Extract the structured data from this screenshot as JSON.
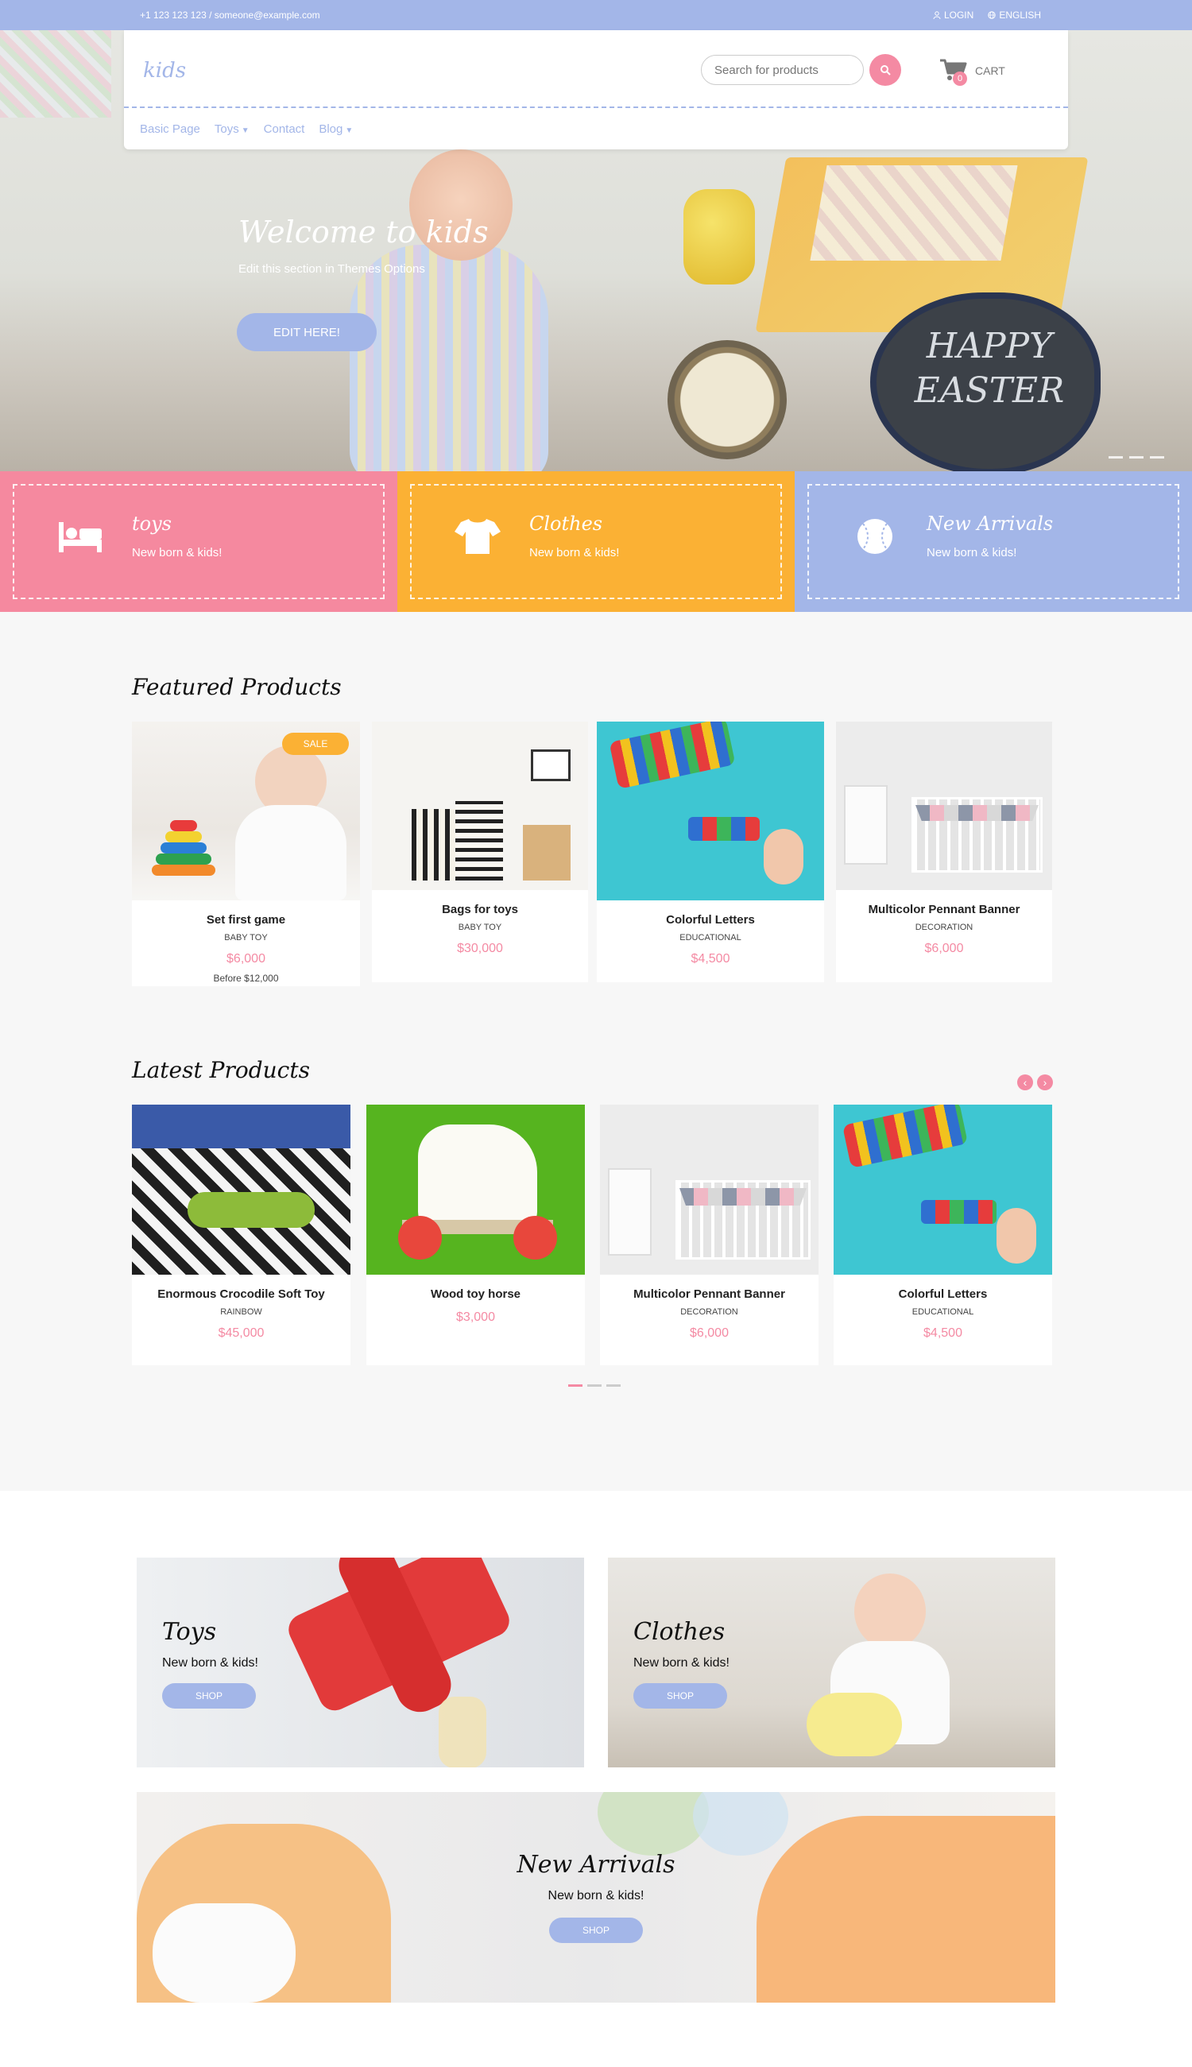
{
  "topbar": {
    "contact": "+1 123 123 123 /  someone@example.com",
    "login": "LOGIN",
    "language": "ENGLISH"
  },
  "header": {
    "logo": "kids",
    "search_placeholder": "Search for products",
    "cart_count": "0",
    "cart_label": "CART",
    "nav": [
      {
        "label": "Basic Page"
      },
      {
        "label": "Toys"
      },
      {
        "label": "Contact"
      },
      {
        "label": "Blog"
      }
    ]
  },
  "hero": {
    "title": "Welcome to kids",
    "subtitle": "Edit this section in Themes Options",
    "button": "EDIT HERE!",
    "chalkboard": "HAPPY EASTER"
  },
  "tiles": [
    {
      "name": "toys",
      "sub": "New born & kids!",
      "color": "#f5899f",
      "icon": "bed-icon"
    },
    {
      "name": "Clothes",
      "sub": "New born & kids!",
      "color": "#fbb134",
      "icon": "tshirt-icon"
    },
    {
      "name": "New Arrivals",
      "sub": "New born & kids!",
      "color": "#a3b6e8",
      "icon": "baseball-icon"
    }
  ],
  "featured": {
    "title": "Featured Products",
    "sale_label": "SALE",
    "items": [
      {
        "name": "Set first game",
        "category": "BABY TOY",
        "price": "$6,000",
        "before": "Before $12,000"
      },
      {
        "name": "Bags for toys",
        "category": "BABY TOY",
        "price": "$30,000"
      },
      {
        "name": "Colorful Letters",
        "category": "EDUCATIONAL",
        "price": "$4,500"
      },
      {
        "name": "Multicolor Pennant Banner",
        "category": "DECORATION",
        "price": "$6,000"
      }
    ]
  },
  "latest": {
    "title": "Latest Products",
    "items": [
      {
        "name": "Enormous Crocodile Soft Toy",
        "category": "RAINBOW",
        "price": "$45,000"
      },
      {
        "name": "Wood toy horse",
        "category": "",
        "price": "$3,000"
      },
      {
        "name": "Multicolor Pennant Banner",
        "category": "DECORATION",
        "price": "$6,000"
      },
      {
        "name": "Colorful Letters",
        "category": "EDUCATIONAL",
        "price": "$4,500"
      }
    ]
  },
  "banners": [
    {
      "title": "Toys",
      "sub": "New born & kids!",
      "button": "SHOP"
    },
    {
      "title": "Clothes",
      "sub": "New born & kids!",
      "button": "SHOP"
    },
    {
      "title": "New Arrivals",
      "sub": "New born & kids!",
      "button": "SHOP"
    }
  ],
  "colors": {
    "accent_blue": "#a3b6e8",
    "accent_pink": "#f48aa3",
    "accent_orange": "#fbb134"
  }
}
